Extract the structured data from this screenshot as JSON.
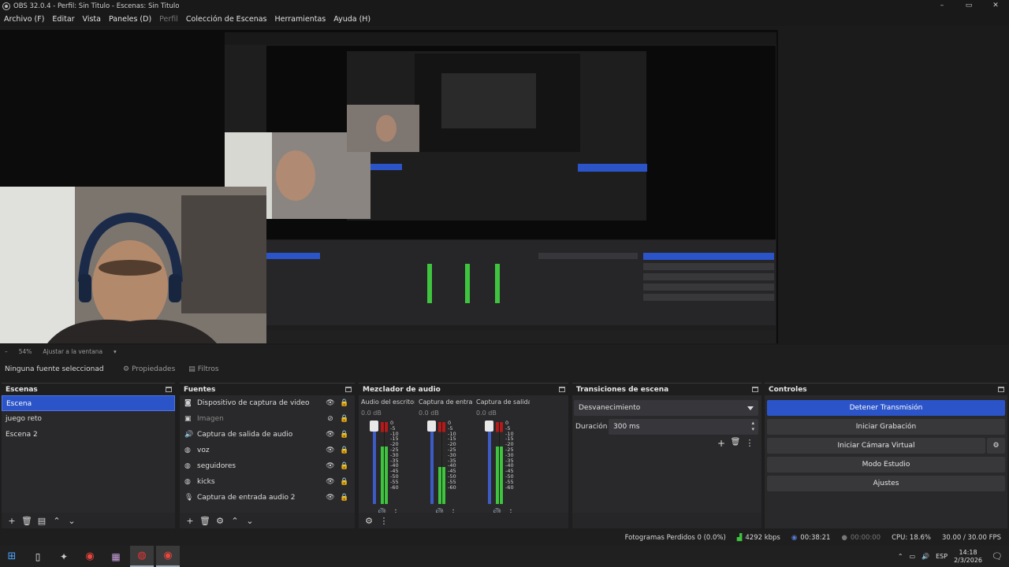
{
  "window": {
    "title": "OBS 32.0.4 - Perfil: Sin Titulo - Escenas: Sin Titulo",
    "controls": [
      "–",
      "▭",
      "✕"
    ]
  },
  "menu": {
    "items": [
      "Archivo (F)",
      "Editar",
      "Vista",
      "Paneles (D)",
      "Perfil",
      "Colección de Escenas",
      "Herramientas",
      "Ayuda (H)"
    ]
  },
  "preview": {
    "zoom_minus": "–",
    "zoom_level": "54%",
    "zoom_mode": "Ajustar a la ventana"
  },
  "context_bar": {
    "no_source": "Ninguna fuente seleccionad",
    "properties": "Propiedades",
    "filters": "Filtros"
  },
  "scenes": {
    "title": "Escenas",
    "items": [
      "Escena",
      "juego reto",
      "Escena 2"
    ],
    "selected": "Escena"
  },
  "sources": {
    "title": "Fuentes",
    "items": [
      {
        "name": "Dispositivo de captura de video",
        "icon": "camera-icon"
      },
      {
        "name": "Imagen",
        "icon": "image-icon"
      },
      {
        "name": "Captura de salida de audio",
        "icon": "speaker-icon"
      },
      {
        "name": "voz",
        "icon": "globe-icon"
      },
      {
        "name": "seguidores",
        "icon": "globe-icon"
      },
      {
        "name": "kicks",
        "icon": "globe-icon"
      },
      {
        "name": "Captura de entrada audio 2",
        "icon": "microphone-icon"
      }
    ]
  },
  "mixer": {
    "title": "Mezclador de audio",
    "channels": [
      {
        "name": "Audio del escritorio",
        "db": "0.0 dB",
        "level": 0.7
      },
      {
        "name": "Captura de entrada",
        "db": "0.0 dB",
        "level": 0.45
      },
      {
        "name": "Captura de salida d",
        "db": "0.0 dB",
        "level": 0.7
      }
    ],
    "scale": [
      "0",
      "-5",
      "-10",
      "-15",
      "-20",
      "-25",
      "-30",
      "-35",
      "-40",
      "-45",
      "-50",
      "-55",
      "-60"
    ]
  },
  "transitions": {
    "title": "Transiciones de escena",
    "type": "Desvanecimiento",
    "duration_label": "Duración",
    "duration_value": "300 ms"
  },
  "controls": {
    "title": "Controles",
    "stop_stream": "Detener Transmisión",
    "start_recording": "Iniciar Grabación",
    "start_virtual_cam": "Iniciar Cámara Virtual",
    "studio_mode": "Modo Estudio",
    "settings": "Ajustes"
  },
  "status": {
    "dropped_frames": "Fotogramas Perdidos 0 (0.0%)",
    "bitrate": "4292 kbps",
    "stream_time": "00:38:21",
    "record_time": "00:00:00",
    "cpu": "CPU: 18.6%",
    "fps": "30.00 / 30.00 FPS"
  },
  "taskbar": {
    "lang": "ESP",
    "time": "14:18",
    "date": "2/3/2026"
  },
  "colors": {
    "accent": "#2b54c8",
    "bg": "#1f1e1f",
    "dock": "#29282a",
    "meter_green": "#3ec43e",
    "meter_red": "#b51a1a"
  }
}
